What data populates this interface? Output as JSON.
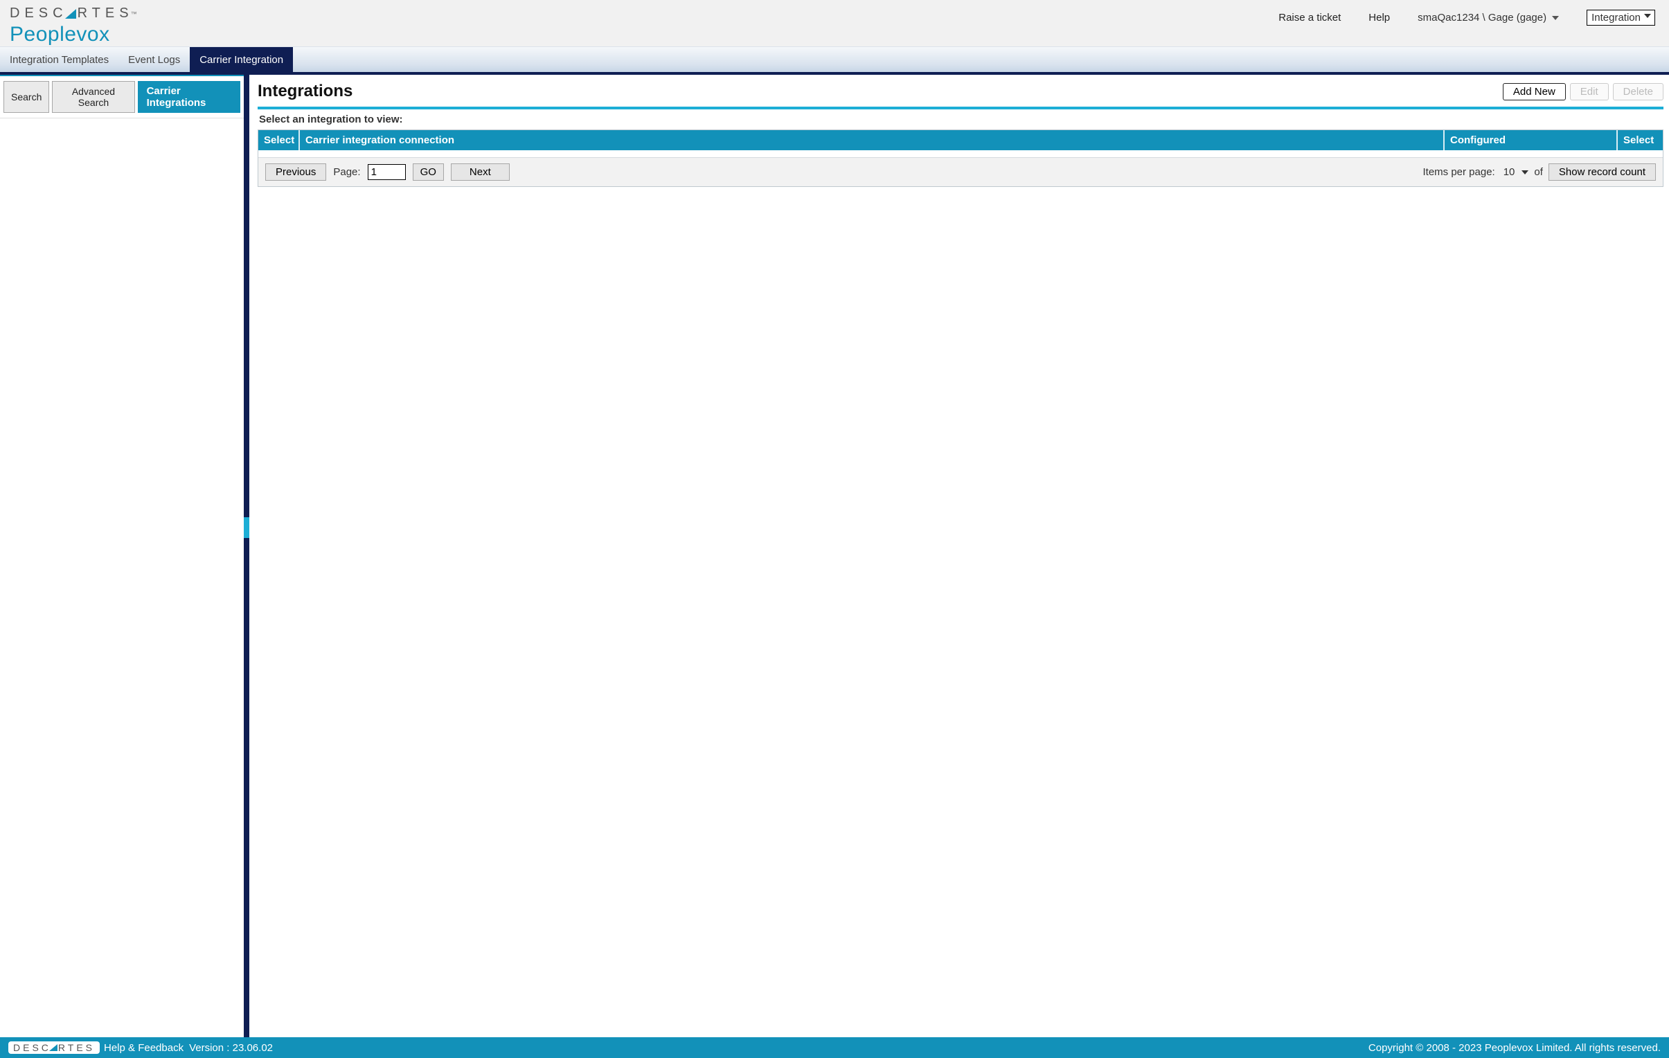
{
  "brand": {
    "top": "DESC",
    "top2": "RTES",
    "tm": "™",
    "sub": "Peoplevox"
  },
  "header": {
    "raise_ticket": "Raise a ticket",
    "help": "Help",
    "user": "smaQac1234 \\ Gage (gage)",
    "module": "Integration"
  },
  "navtabs": {
    "templates": "Integration Templates",
    "event_logs": "Event Logs",
    "carrier": "Carrier Integration"
  },
  "left": {
    "search": "Search",
    "advanced": "Advanced Search",
    "carrier_tab": "Carrier Integrations"
  },
  "page": {
    "title": "Integrations",
    "add_new": "Add New",
    "edit": "Edit",
    "delete": "Delete",
    "select_label": "Select an integration to view:"
  },
  "grid": {
    "cols": {
      "select1": "Select",
      "conn": "Carrier integration connection",
      "conf": "Configured",
      "select2": "Select"
    },
    "prev": "Previous",
    "next": "Next",
    "page_label": "Page:",
    "page_value": "1",
    "go": "GO",
    "ipp_label": "Items per page:",
    "ipp_value": "10",
    "of": "of",
    "show_count": "Show record count"
  },
  "footer": {
    "help_feedback": "Help & Feedback",
    "version": "Version : 23.06.02",
    "copyright": "Copyright © 2008 - 2023 Peoplevox Limited. All rights reserved."
  }
}
